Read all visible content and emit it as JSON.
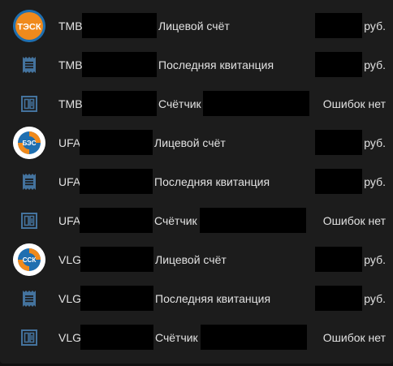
{
  "colors": {
    "background": "#111111",
    "card": "#1c1c1c",
    "text": "#e1e1e1",
    "icon": "#44739e",
    "logo_orange": "#f08a1c",
    "logo_blue": "#1f6fb0"
  },
  "rows": [
    {
      "icon": "logo-tesk",
      "logo_text": "ТЭСК",
      "prefix": "TMB",
      "label": "Лицевой счёт",
      "value": "руб."
    },
    {
      "icon": "receipt-icon",
      "prefix": "TMB",
      "label": "Последняя квитанция",
      "value": "руб."
    },
    {
      "icon": "meter-icon",
      "prefix": "TMB",
      "label": "Счётчик",
      "value": "Ошибок нет"
    },
    {
      "icon": "logo-bes",
      "logo_text": "БЭС",
      "prefix": "UFA",
      "label": "Лицевой счёт",
      "value": "руб."
    },
    {
      "icon": "receipt-icon",
      "prefix": "UFA",
      "label": "Последняя квитанция",
      "value": "руб."
    },
    {
      "icon": "meter-icon",
      "prefix": "UFA",
      "label": "Счётчик",
      "value": "Ошибок нет"
    },
    {
      "icon": "logo-ssk",
      "logo_text": "ССК",
      "prefix": "VLG",
      "label": "Лицевой счёт",
      "value": "руб."
    },
    {
      "icon": "receipt-icon",
      "prefix": "VLG",
      "label": "Последняя квитанция",
      "value": "руб."
    },
    {
      "icon": "meter-icon",
      "prefix": "VLG",
      "label": "Счётчик",
      "value": "Ошибок нет"
    }
  ]
}
